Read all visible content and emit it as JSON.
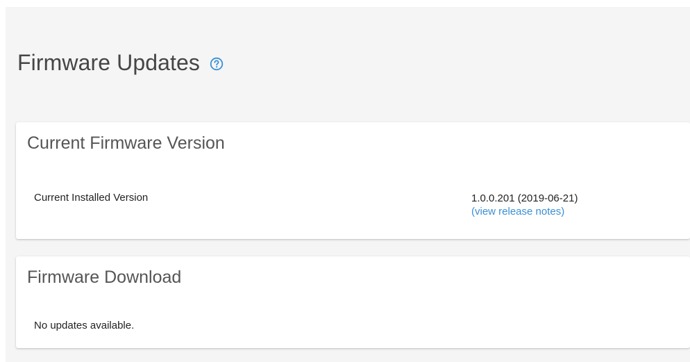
{
  "page": {
    "title": "Firmware Updates",
    "help_icon": "question-circle-icon"
  },
  "current_firmware": {
    "title": "Current Firmware Version",
    "installed_label": "Current Installed Version",
    "installed_value": "1.0.0.201 (2019-06-21)",
    "release_notes_link": "(view release notes)"
  },
  "firmware_download": {
    "title": "Firmware Download",
    "status": "No updates available."
  },
  "colors": {
    "accent": "#3a8fd6",
    "background": "#f5f5f5",
    "card": "#ffffff"
  }
}
